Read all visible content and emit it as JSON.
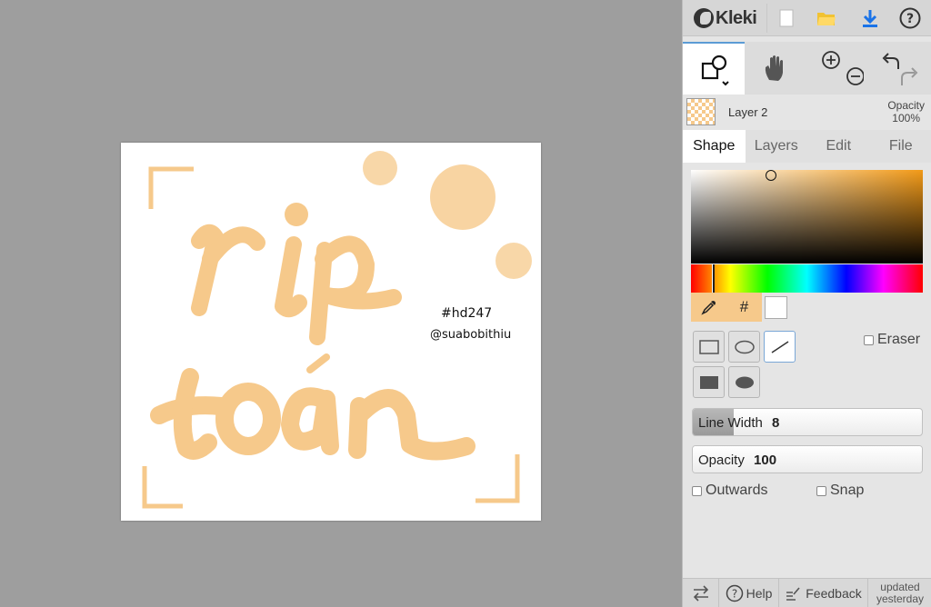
{
  "app": {
    "logo_text": "Kleki",
    "colors": {
      "accent": "#5b9bd5",
      "peach": "#f6c98b",
      "panel_bg": "#e5e5e5",
      "workspace_bg": "#9e9e9e"
    }
  },
  "toolbar": {
    "icons": [
      "new-image-icon",
      "open-folder-icon",
      "download-icon",
      "help-icon"
    ]
  },
  "tools": {
    "active": "shape",
    "icons": [
      "shape-tool-icon",
      "hand-tool-icon",
      "zoom-in-icon",
      "zoom-out-icon",
      "undo-icon",
      "redo-icon"
    ]
  },
  "layer": {
    "name": "Layer 2",
    "opacity_label": "Opacity",
    "opacity_value": "100%"
  },
  "tabs": [
    {
      "label": "Shape",
      "active": true
    },
    {
      "label": "Layers",
      "active": false
    },
    {
      "label": "Edit",
      "active": false
    },
    {
      "label": "File",
      "active": false
    }
  ],
  "color": {
    "selected": "#f29a18",
    "secondary": "#ffffff",
    "hex_button": "#"
  },
  "shape": {
    "eraser_label": "Eraser",
    "line_width_label": "Line Width",
    "line_width_value": "8",
    "line_width_fraction": 0.18,
    "opacity_label": "Opacity",
    "opacity_value": "100",
    "opacity_fraction": 1.0,
    "outwards_label": "Outwards",
    "snap_label": "Snap"
  },
  "canvas": {
    "text_hashtag": "#hd247",
    "text_handle": "@suabobithiu",
    "lettering": "rip toán"
  },
  "bottombar": {
    "help_label": "Help",
    "feedback_label": "Feedback",
    "updated_line1": "updated",
    "updated_line2": "yesterday"
  }
}
